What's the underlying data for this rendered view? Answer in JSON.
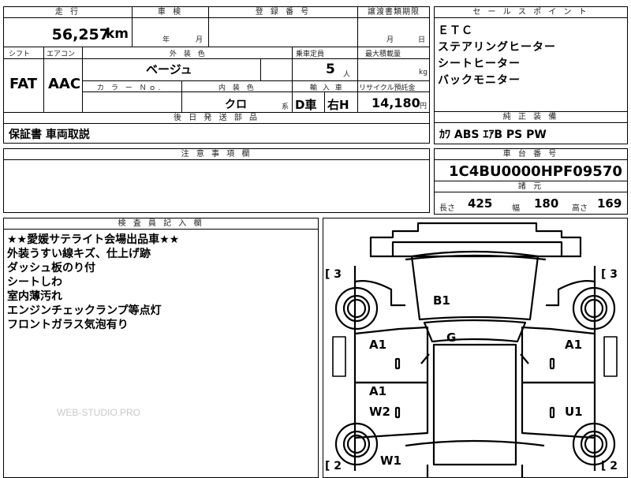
{
  "top": {
    "mileage_header": "走 行",
    "mileage_value": "56,257",
    "mileage_unit": "km",
    "inspection_header": "車 検",
    "inspection_year_unit": "年",
    "inspection_month_unit": "月",
    "registration_header": "登 録 番 号",
    "transfer_header": "譲渡書類期限",
    "transfer_month_unit": "月",
    "transfer_day_unit": "日"
  },
  "row2": {
    "shift_header": "シフト",
    "shift_value": "FAT",
    "ac_header": "エアコン",
    "ac_value": "AAC",
    "exterior_header": "外 装 色",
    "exterior_value": "ベージュ",
    "capacity_header": "乗車定員",
    "capacity_value": "5",
    "capacity_unit": "人",
    "maxload_header": "最大積載量",
    "maxload_unit": "kg",
    "colorno_header": "カ ラ ー Ｎｏ.",
    "interior_header": "内 装 色",
    "interior_value": "クロ",
    "interior_unit": "系",
    "import_header": "輸 入 車",
    "import_d": "D車",
    "import_h": "右H",
    "recycle_header": "リサイクル預託金",
    "recycle_value": "14,180",
    "recycle_unit": "円"
  },
  "later_parts": {
    "header": "後 日 発 送 部 品",
    "value": "保証書 車両取説"
  },
  "caution": {
    "header": "注 意 事 項 欄"
  },
  "sales_points": {
    "header": "セ ー ル ス ポ イ ン ト",
    "items": [
      "ＥＴＣ",
      "ステアリングヒーター",
      "シートヒーター",
      "バックモニター"
    ]
  },
  "equipment": {
    "header": "純 正 装 備",
    "value": "ｶﾜ ABS ｴｱB PS PW"
  },
  "chassis": {
    "header": "車 台 番 号",
    "value": "1C4BU0000HPF09570"
  },
  "dimensions": {
    "header": "諸 元",
    "length_label": "長さ",
    "length_value": "425",
    "width_label": "幅",
    "width_value": "180",
    "height_label": "高さ",
    "height_value": "169"
  },
  "inspector": {
    "header": "検 査 員 記 入 欄",
    "notes": [
      "★★愛媛サテライト会場出品車★★",
      "外装うすい線キズ、仕上げ跡",
      "ダッシュ板のり付",
      "シートしわ",
      "室内薄汚れ",
      "エンジンチェックランプ等点灯",
      "フロントガラス気泡有り"
    ]
  },
  "damage_map": {
    "tire_front_left": "[ 3",
    "tire_front_right": "[ 3",
    "tire_rear_left": "[ 2",
    "tire_rear_right": "[ 2",
    "marks": {
      "hood": "B1",
      "roof": "G",
      "front_left_door": "A1",
      "front_right_door": "A1",
      "rear_left_door_1": "A1",
      "rear_left_door_2": "W2",
      "rear_right_door": "U1",
      "rear_bottom": "W1"
    }
  },
  "watermark": "WEB-STUDIO.PRO"
}
